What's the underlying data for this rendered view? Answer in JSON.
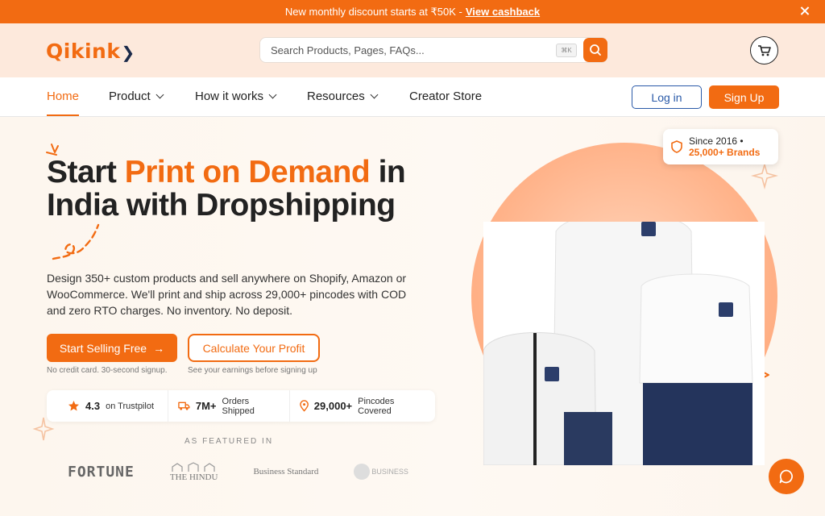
{
  "announcement": {
    "text": "New monthly discount starts at ₹50K -",
    "link": "View cashback"
  },
  "header": {
    "logo": "Qikink",
    "search_placeholder": "Search Products, Pages, FAQs...",
    "search_shortcut": "⌘K"
  },
  "nav": {
    "items": [
      {
        "label": "Home"
      },
      {
        "label": "Product"
      },
      {
        "label": "How it works"
      },
      {
        "label": "Resources"
      },
      {
        "label": "Creator Store"
      }
    ],
    "login": "Log in",
    "signup": "Sign Up"
  },
  "hero": {
    "headline_part1": "Start",
    "headline_highlight": "Print on Demand",
    "headline_part2": "in",
    "headline_line2": "India with Dropshipping",
    "subtext": "Design 350+ custom products and sell anywhere on Shopify, Amazon or WooCommerce. We'll print and ship across 29,000+ pincodes with COD and zero RTO charges. No inventory. No deposit.",
    "primary_cta": "Start Selling Free",
    "primary_note": "No credit card. 30-second signup.",
    "secondary_cta": "Calculate Your Profit",
    "secondary_note": "See your earnings before signing up",
    "stats": [
      {
        "value": "4.3",
        "label": "on Trustpilot"
      },
      {
        "value": "7M+",
        "label": "Orders Shipped"
      },
      {
        "value": "29,000+",
        "label": "Pincodes Covered"
      }
    ],
    "featured_label": "AS FEATURED IN",
    "press": [
      "FORTUNE",
      "THE HINDU",
      "Business Standard",
      "BUSINESS"
    ],
    "badge_line1": "Since 2016 •",
    "badge_line2": "25,000+ Brands"
  },
  "colors": {
    "brand": "#f26b12",
    "link_blue": "#2a5aa8"
  }
}
